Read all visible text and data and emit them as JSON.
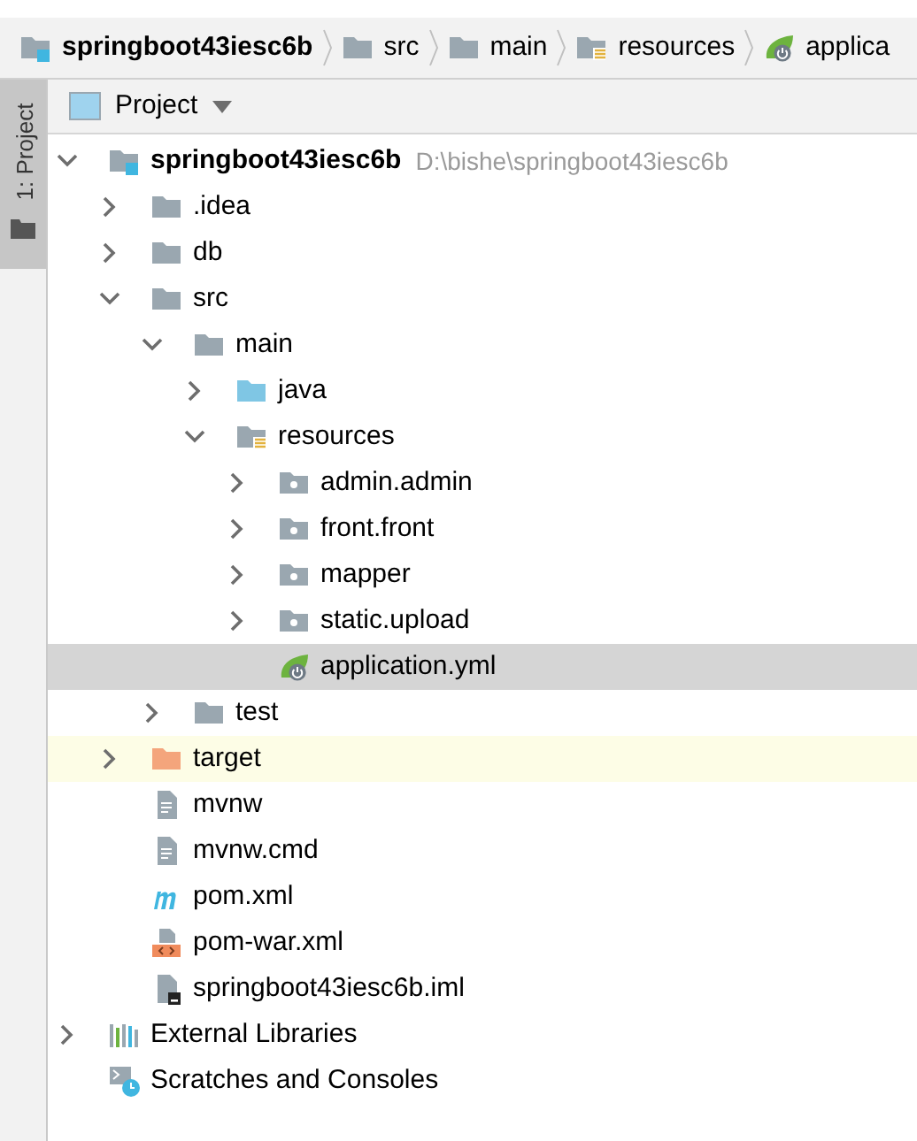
{
  "breadcrumbs": [
    {
      "label": "springboot43iesc6b",
      "kind": "module"
    },
    {
      "label": "src",
      "kind": "folder"
    },
    {
      "label": "main",
      "kind": "folder"
    },
    {
      "label": "resources",
      "kind": "resources"
    },
    {
      "label": "applica",
      "kind": "yml"
    }
  ],
  "side_tab": {
    "label": "1: Project",
    "selected": true
  },
  "panel": {
    "title": "Project"
  },
  "tree": [
    {
      "label": "springboot43iesc6b",
      "path": "D:\\bishe\\springboot43iesc6b",
      "kind": "module",
      "expanded": true,
      "selected": false,
      "highlighted": false,
      "children": [
        {
          "label": ".idea",
          "kind": "folder",
          "expanded": false,
          "selected": false,
          "highlighted": false
        },
        {
          "label": "db",
          "kind": "folder",
          "expanded": false,
          "selected": false,
          "highlighted": false
        },
        {
          "label": "src",
          "kind": "folder",
          "expanded": true,
          "selected": false,
          "highlighted": false,
          "children": [
            {
              "label": "main",
              "kind": "folder",
              "expanded": true,
              "selected": false,
              "highlighted": false,
              "children": [
                {
                  "label": "java",
                  "kind": "source",
                  "expanded": false,
                  "selected": false,
                  "highlighted": false
                },
                {
                  "label": "resources",
                  "kind": "resources",
                  "expanded": true,
                  "selected": false,
                  "highlighted": false,
                  "children": [
                    {
                      "label": "admin.admin",
                      "kind": "package",
                      "expanded": false,
                      "selected": false,
                      "highlighted": false
                    },
                    {
                      "label": "front.front",
                      "kind": "package",
                      "expanded": false,
                      "selected": false,
                      "highlighted": false
                    },
                    {
                      "label": "mapper",
                      "kind": "package",
                      "expanded": false,
                      "selected": false,
                      "highlighted": false
                    },
                    {
                      "label": "static.upload",
                      "kind": "package",
                      "expanded": false,
                      "selected": false,
                      "highlighted": false
                    },
                    {
                      "label": "application.yml",
                      "kind": "yml",
                      "selected": true,
                      "highlighted": false
                    }
                  ]
                }
              ]
            },
            {
              "label": "test",
              "kind": "folder",
              "expanded": false,
              "selected": false,
              "highlighted": false
            }
          ]
        },
        {
          "label": "target",
          "kind": "excluded",
          "expanded": false,
          "selected": false,
          "highlighted": true
        },
        {
          "label": "mvnw",
          "kind": "file",
          "selected": false,
          "highlighted": false
        },
        {
          "label": "mvnw.cmd",
          "kind": "file",
          "selected": false,
          "highlighted": false
        },
        {
          "label": "pom.xml",
          "kind": "maven",
          "selected": false,
          "highlighted": false
        },
        {
          "label": "pom-war.xml",
          "kind": "xml",
          "selected": false,
          "highlighted": false
        },
        {
          "label": "springboot43iesc6b.iml",
          "kind": "iml",
          "selected": false,
          "highlighted": false
        }
      ]
    },
    {
      "label": "External Libraries",
      "kind": "libraries",
      "expanded": false,
      "selected": false,
      "highlighted": false
    },
    {
      "label": "Scratches and Consoles",
      "kind": "scratches",
      "selected": false,
      "highlighted": false
    }
  ]
}
